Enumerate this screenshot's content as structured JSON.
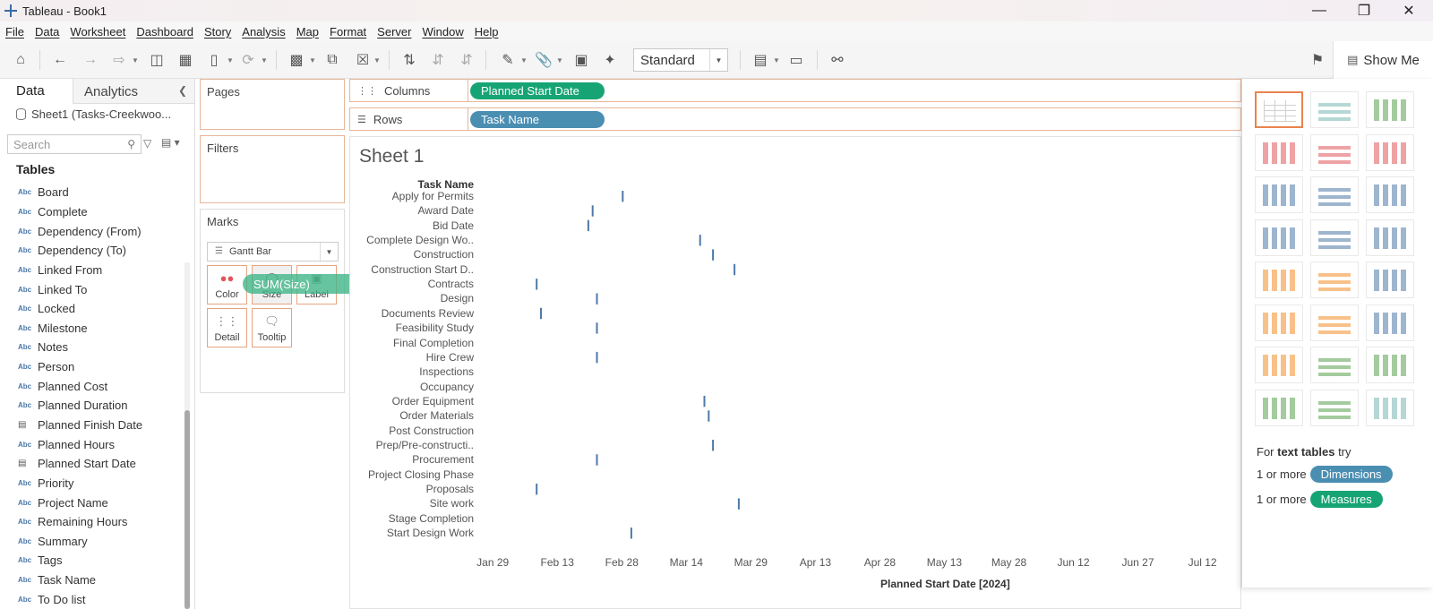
{
  "window": {
    "title": "Tableau - Book1"
  },
  "menu": [
    "File",
    "Data",
    "Worksheet",
    "Dashboard",
    "Story",
    "Analysis",
    "Map",
    "Format",
    "Server",
    "Window",
    "Help"
  ],
  "toolbar": {
    "fit_mode": "Standard",
    "show_me_label": "Show Me"
  },
  "data_pane": {
    "tab_data": "Data",
    "tab_analytics": "Analytics",
    "datasource": "Sheet1 (Tasks-Creekwoo...",
    "search_placeholder": "Search",
    "tables_heading": "Tables",
    "fields": [
      {
        "type": "Abc",
        "name": "Board"
      },
      {
        "type": "Abc",
        "name": "Complete"
      },
      {
        "type": "Abc",
        "name": "Dependency (From)"
      },
      {
        "type": "Abc",
        "name": "Dependency (To)"
      },
      {
        "type": "Abc",
        "name": "Linked From"
      },
      {
        "type": "Abc",
        "name": "Linked To"
      },
      {
        "type": "Abc",
        "name": "Locked"
      },
      {
        "type": "Abc",
        "name": "Milestone"
      },
      {
        "type": "Abc",
        "name": "Notes"
      },
      {
        "type": "Abc",
        "name": "Person"
      },
      {
        "type": "Abc",
        "name": "Planned Cost"
      },
      {
        "type": "Abc",
        "name": "Planned Duration"
      },
      {
        "type": "date",
        "name": "Planned Finish Date"
      },
      {
        "type": "Abc",
        "name": "Planned Hours"
      },
      {
        "type": "date",
        "name": "Planned Start Date"
      },
      {
        "type": "Abc",
        "name": "Priority"
      },
      {
        "type": "Abc",
        "name": "Project Name"
      },
      {
        "type": "Abc",
        "name": "Remaining Hours"
      },
      {
        "type": "Abc",
        "name": "Summary"
      },
      {
        "type": "Abc",
        "name": "Tags"
      },
      {
        "type": "Abc",
        "name": "Task Name"
      },
      {
        "type": "Abc",
        "name": "To Do list"
      }
    ]
  },
  "cards": {
    "pages": "Pages",
    "filters": "Filters",
    "marks": "Marks",
    "mark_type": "Gantt Bar",
    "color": "Color",
    "size": "Size",
    "label": "Label",
    "detail": "Detail",
    "tooltip": "Tooltip",
    "dragging_pill": "SUM(Size)"
  },
  "shelves": {
    "columns_label": "Columns",
    "columns_pill": "Planned Start Date",
    "rows_label": "Rows",
    "rows_pill": "Task Name"
  },
  "sheet": {
    "title": "Sheet 1",
    "row_header": "Task Name"
  },
  "chart_data": {
    "type": "gantt",
    "x_axis_label": "Planned Start Date [2024]",
    "x_ticks": [
      "Jan 29",
      "Feb 13",
      "Feb 28",
      "Mar 14",
      "Mar 29",
      "Apr 13",
      "Apr 28",
      "May 13",
      "May 28",
      "Jun 12",
      "Jun 27",
      "Jul 12"
    ],
    "x_range": [
      "2024-01-25",
      "2024-07-20"
    ],
    "mark_color": "#4e79a7",
    "rows": [
      {
        "task": "Apply for Permits",
        "start": "2024-02-28"
      },
      {
        "task": "Award Date",
        "start": "2024-02-21"
      },
      {
        "task": "Bid Date",
        "start": "2024-02-20"
      },
      {
        "task": "Complete Design Wo..",
        "start": "2024-03-17"
      },
      {
        "task": "Construction",
        "start": "2024-03-20"
      },
      {
        "task": "Construction Start D..",
        "start": "2024-03-25"
      },
      {
        "task": "Contracts",
        "start": "2024-02-08"
      },
      {
        "task": "Design",
        "start": "2024-02-22"
      },
      {
        "task": "Documents Review",
        "start": "2024-02-09"
      },
      {
        "task": "Feasibility Study",
        "start": "2024-02-22"
      },
      {
        "task": "Final Completion",
        "start": null
      },
      {
        "task": "Hire Crew",
        "start": "2024-02-22"
      },
      {
        "task": "Inspections",
        "start": null
      },
      {
        "task": "Occupancy",
        "start": null
      },
      {
        "task": "Order Equipment",
        "start": "2024-03-18"
      },
      {
        "task": "Order Materials",
        "start": "2024-03-19"
      },
      {
        "task": "Post Construction",
        "start": null
      },
      {
        "task": "Prep/Pre-constructi..",
        "start": "2024-03-20"
      },
      {
        "task": "Procurement",
        "start": "2024-02-22"
      },
      {
        "task": "Project Closing Phase",
        "start": null
      },
      {
        "task": "Proposals",
        "start": "2024-02-08"
      },
      {
        "task": "Site work",
        "start": "2024-03-26"
      },
      {
        "task": "Stage Completion",
        "start": null
      },
      {
        "task": "Start Design Work",
        "start": "2024-03-01"
      }
    ]
  },
  "show_me": {
    "hint_prefix": "For",
    "hint_bold": "text tables",
    "hint_suffix": "try",
    "line1_prefix": "1 or more",
    "line1_pill": "Dimensions",
    "line2_prefix": "1 or more",
    "line2_pill": "Measures",
    "dimensions_color": "#4a8eb2",
    "measures_color": "#17a475"
  }
}
